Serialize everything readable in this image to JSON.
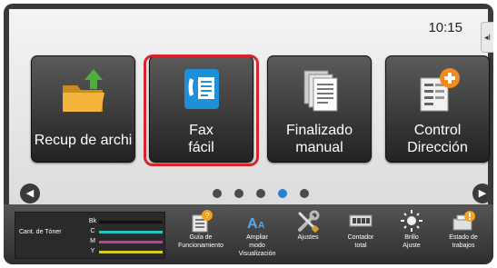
{
  "clock": "10:15",
  "side_handle": "◂I",
  "tiles": [
    {
      "label": "Recup de archi",
      "icon": "folder-icon"
    },
    {
      "label": "Fax\nfácil",
      "icon": "fax-icon"
    },
    {
      "label": "Finalizado\nmanual",
      "icon": "document-stack-icon"
    },
    {
      "label": "Control\nDirección",
      "icon": "address-book-plus-icon"
    }
  ],
  "selected_tile": 1,
  "pager": {
    "prev": "◀",
    "next": "▶",
    "pages": 5,
    "active_page": 3
  },
  "toner": {
    "title": "Cant. de Tóner",
    "rows": [
      {
        "letter": "Bk",
        "color": "#111111"
      },
      {
        "letter": "C",
        "color": "#2bc4c4"
      },
      {
        "letter": "M",
        "color": "#c43aa0"
      },
      {
        "letter": "Y",
        "color": "#d8cc2a"
      }
    ]
  },
  "taskbar": [
    {
      "label": "Guía de\nFuncionamiento",
      "icon": "guide-book-icon"
    },
    {
      "label": "Ampliar\nmodo\nVisualización",
      "icon": "enlarge-text-icon"
    },
    {
      "label": "Ajustes",
      "icon": "wrench-screwdriver-icon"
    },
    {
      "label": "Contador\ntotal",
      "icon": "counter-icon"
    },
    {
      "label": "Brillo\nAjuste",
      "icon": "brightness-icon"
    },
    {
      "label": "Estado de\ntrabajos",
      "icon": "job-status-icon"
    }
  ],
  "colors": {
    "selection": "#d6242e",
    "active_dot": "#2a7fd4",
    "fax_blue": "#1e8fd8",
    "plus_orange": "#f28a1e"
  }
}
